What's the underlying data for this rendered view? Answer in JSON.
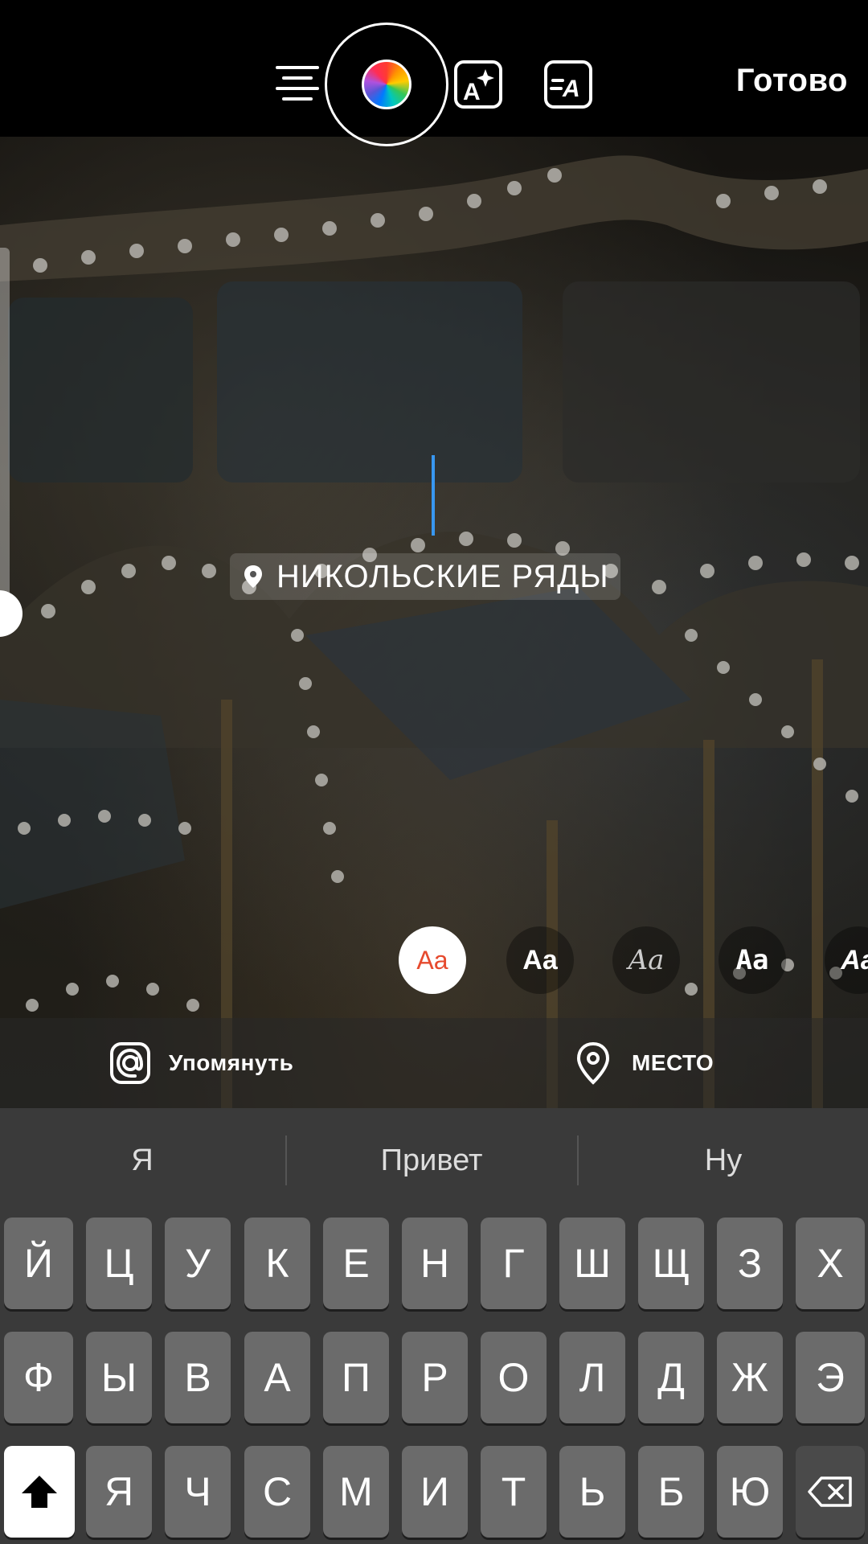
{
  "toolbar": {
    "done_label": "Готово"
  },
  "location_sticker": {
    "text": "НИКОЛЬСКИЕ РЯДЫ"
  },
  "font_styles": [
    {
      "label": "Aa",
      "selected": true
    },
    {
      "label": "Aa"
    },
    {
      "label": "Aa"
    },
    {
      "label": "Aa"
    },
    {
      "label": "Aa"
    }
  ],
  "actions": {
    "mention_label": "Упомянуть",
    "location_label": "МЕСТО"
  },
  "keyboard": {
    "suggestions": [
      "Я",
      "Привет",
      "Ну"
    ],
    "row1": [
      "Й",
      "Ц",
      "У",
      "К",
      "Е",
      "Н",
      "Г",
      "Ш",
      "Щ",
      "З",
      "Х"
    ],
    "row2": [
      "Ф",
      "Ы",
      "В",
      "А",
      "П",
      "Р",
      "О",
      "Л",
      "Д",
      "Ж",
      "Э"
    ],
    "row3": [
      "Я",
      "Ч",
      "С",
      "М",
      "И",
      "Т",
      "Ь",
      "Б",
      "Ю"
    ]
  },
  "icons": {
    "align": "align-center-icon",
    "color": "color-wheel-icon",
    "effect": "text-effect-icon",
    "animate": "text-animate-icon",
    "mention": "at-sign-icon",
    "location": "location-pin-icon",
    "shift": "shift-arrow-icon",
    "delete": "backspace-icon"
  },
  "colors": {
    "cursor": "#3897f0",
    "selected_font_text": "#e64a2e"
  }
}
